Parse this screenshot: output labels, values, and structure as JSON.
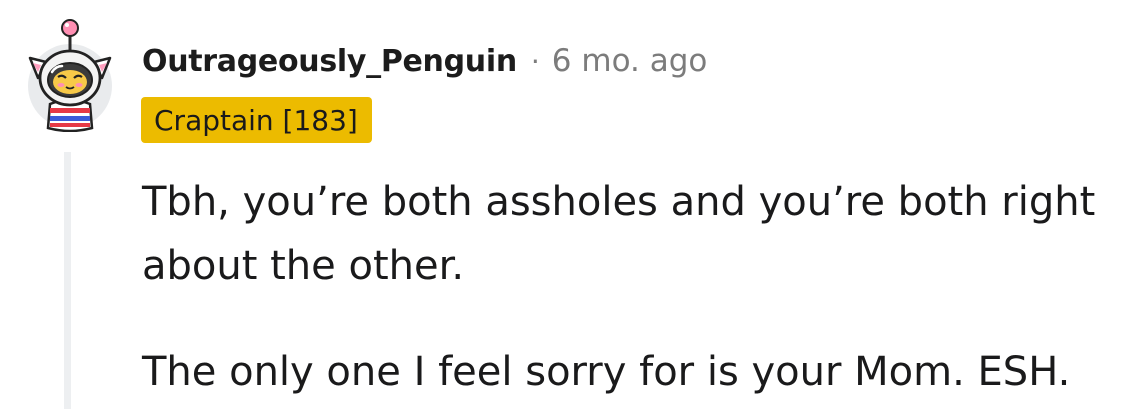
{
  "comment": {
    "author": "Outrageously_Penguin",
    "separator": "·",
    "timestamp": "6 mo. ago",
    "flair": "Craptain [183]",
    "paragraphs": [
      "Tbh, you’re both assholes and you’re both right about the other.",
      "The only one I feel sorry for is your Mom. ESH."
    ]
  },
  "colors": {
    "flair_background": "#ecbb00",
    "thread_line": "#edeff1",
    "meta_gray": "#7c7c7c"
  },
  "icons": {
    "avatar": "snoo-astronaut-cat-avatar"
  }
}
